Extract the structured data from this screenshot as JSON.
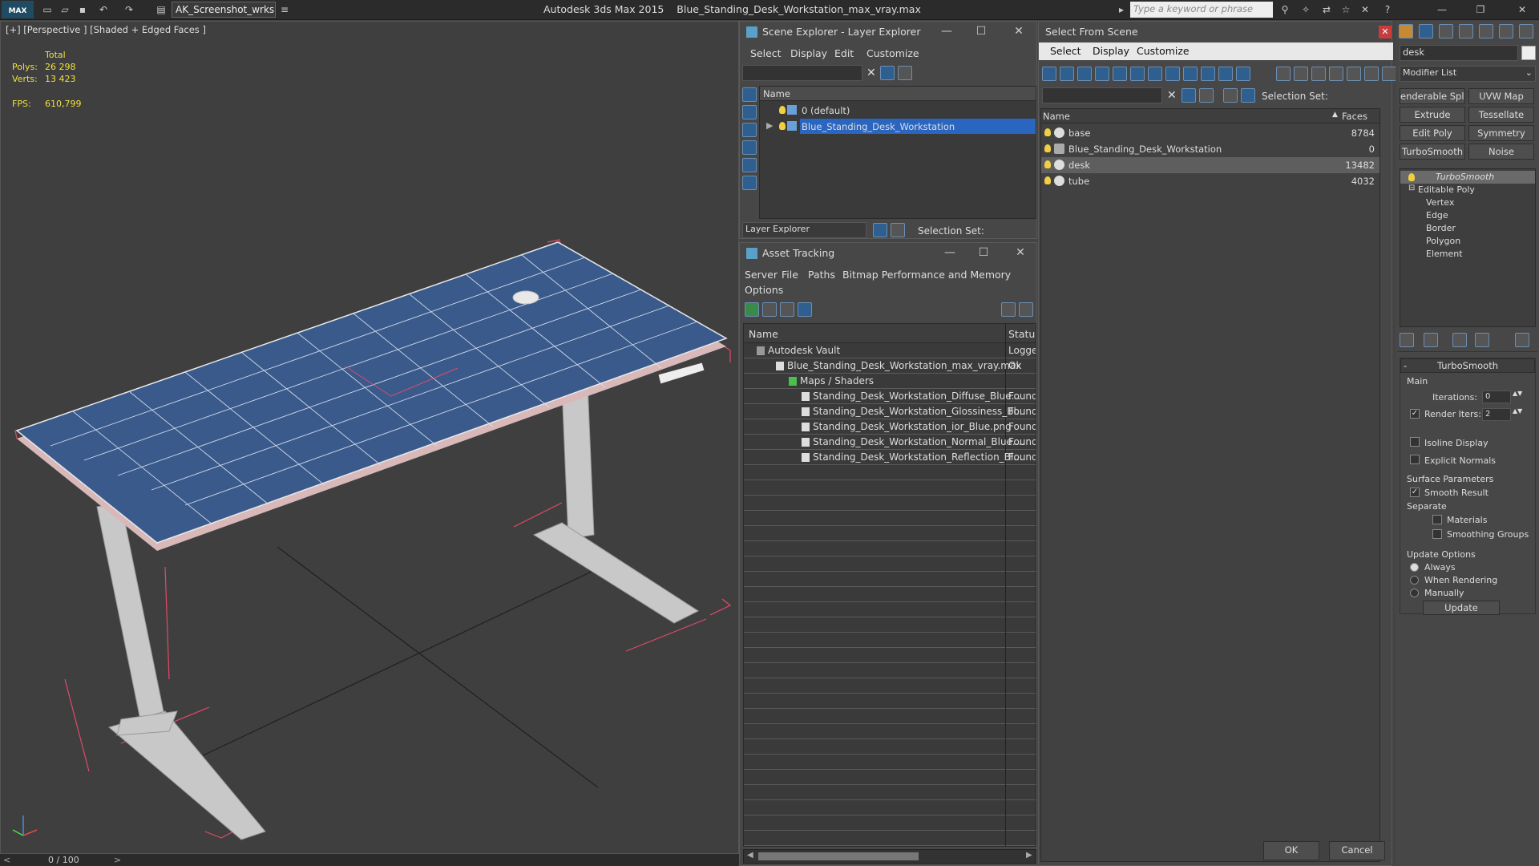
{
  "app": {
    "logo_text": "MAX",
    "workspace": "AK_Screenshot_wrksp",
    "title_prefix": "Autodesk 3ds Max  2015",
    "file_name": "Blue_Standing_Desk_Workstation_max_vray.max",
    "search_placeholder": "Type a keyword or phrase"
  },
  "viewport": {
    "label": "[+] [Perspective ] [Shaded + Edged Faces ]",
    "stats": {
      "total_label": "Total",
      "polys_label": "Polys:",
      "polys": "26 298",
      "verts_label": "Verts:",
      "verts": "13 423",
      "fps_label": "FPS:",
      "fps": "610,799"
    },
    "timeline": "0 / 100",
    "colors": {
      "desk_top": "#3a5a8c",
      "wire": "#d8d8d8",
      "bbox": "#e04a6a"
    }
  },
  "scene_explorer": {
    "title": "Scene Explorer - Layer Explorer",
    "menus": [
      "Select",
      "Display",
      "Edit",
      "Customize"
    ],
    "col_name": "Name",
    "rows": [
      "0 (default)",
      "Blue_Standing_Desk_Workstation"
    ],
    "footer_dropdown": "Layer Explorer",
    "selection_set": "Selection Set:"
  },
  "asset_tracking": {
    "title": "Asset Tracking",
    "menus": [
      "Server",
      "File",
      "Paths",
      "Bitmap Performance and Memory",
      "Options"
    ],
    "col_name": "Name",
    "col_status": "Status",
    "rows": [
      {
        "name": "Autodesk Vault",
        "status": "Logge"
      },
      {
        "name": "Blue_Standing_Desk_Workstation_max_vray.max",
        "status": "Ok"
      },
      {
        "name": "Maps / Shaders",
        "status": ""
      },
      {
        "name": "Standing_Desk_Workstation_Diffuse_Blue....",
        "status": "Found"
      },
      {
        "name": "Standing_Desk_Workstation_Glossiness_Bl...",
        "status": "Found"
      },
      {
        "name": "Standing_Desk_Workstation_ior_Blue.png",
        "status": "Found"
      },
      {
        "name": "Standing_Desk_Workstation_Normal_Blue....",
        "status": "Found"
      },
      {
        "name": "Standing_Desk_Workstation_Reflection_Bl...",
        "status": "Found"
      }
    ]
  },
  "select_from_scene": {
    "title": "Select From Scene",
    "menus": [
      "Select",
      "Display",
      "Customize"
    ],
    "selection_set": "Selection Set:",
    "col_name": "Name",
    "col_faces": "Faces",
    "rows": [
      {
        "name": "base",
        "faces": "8784"
      },
      {
        "name": "Blue_Standing_Desk_Workstation",
        "faces": "0"
      },
      {
        "name": "desk",
        "faces": "13482"
      },
      {
        "name": "tube",
        "faces": "4032"
      }
    ],
    "ok": "OK",
    "cancel": "Cancel"
  },
  "modify_panel": {
    "object_name": "desk",
    "modifier_list": "Modifier List",
    "buttons": [
      "enderable Spli",
      "UVW Map",
      "Extrude",
      "Tessellate",
      "Edit Poly",
      "Symmetry",
      "TurboSmooth",
      "Noise"
    ],
    "stack": [
      "TurboSmooth",
      "Editable Poly",
      "Vertex",
      "Edge",
      "Border",
      "Polygon",
      "Element"
    ],
    "rollout_title": "TurboSmooth",
    "main": "Main",
    "iterations_label": "Iterations:",
    "iterations": "0",
    "render_iters_label": "Render Iters:",
    "render_iters": "2",
    "isoline": "Isoline Display",
    "explicit_normals": "Explicit Normals",
    "surface_params": "Surface Parameters",
    "smooth_result": "Smooth Result",
    "separate": "Separate",
    "materials": "Materials",
    "smoothing_groups": "Smoothing Groups",
    "update_options": "Update Options",
    "always": "Always",
    "when_rendering": "When Rendering",
    "manually": "Manually",
    "update": "Update"
  }
}
